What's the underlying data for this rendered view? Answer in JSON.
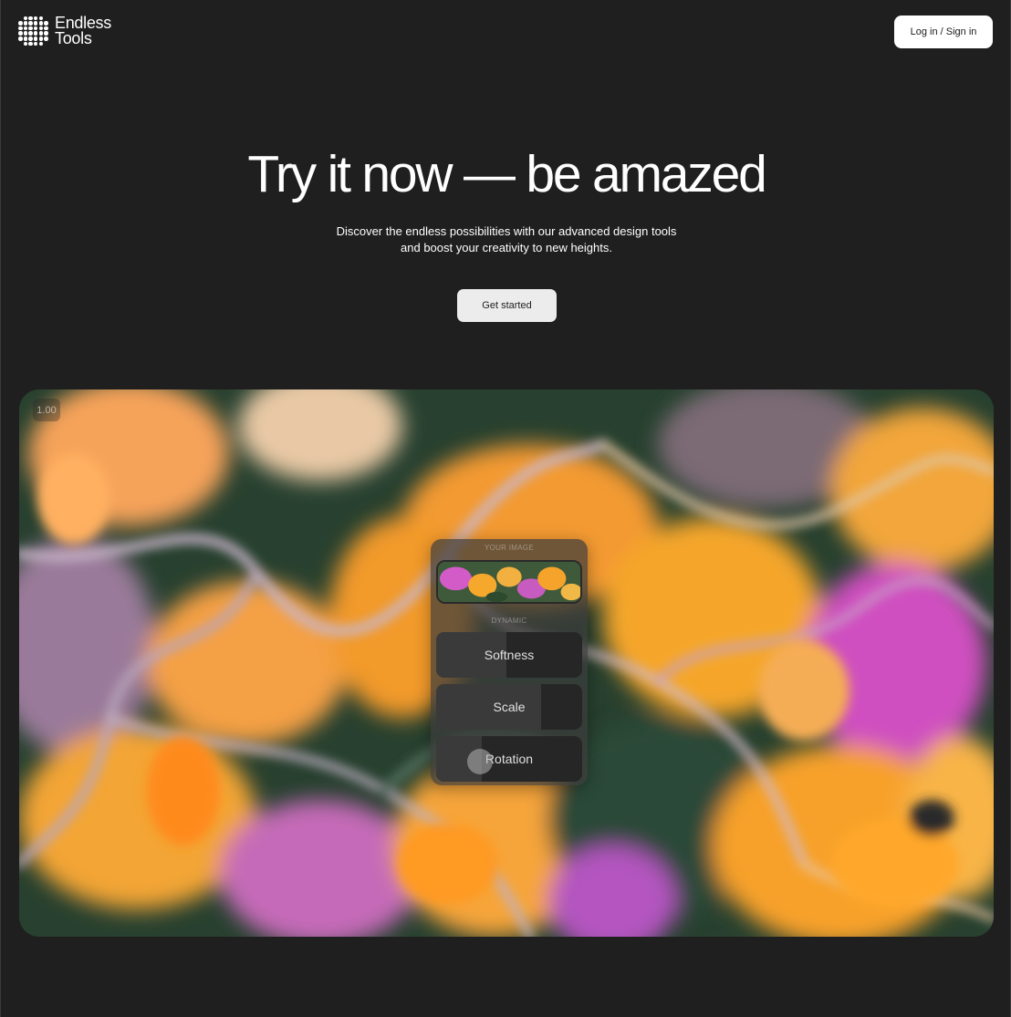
{
  "brand": {
    "name_line1": "Endless",
    "name_line2": "Tools"
  },
  "header": {
    "login_label": "Log in / Sign in"
  },
  "hero": {
    "title": "Try it now — be amazed",
    "subtitle_line1": "Discover the endless possibilities with our advanced design tools",
    "subtitle_line2": "and boost your creativity to new heights.",
    "cta_label": "Get started"
  },
  "demo": {
    "zoom_value": "1.00",
    "panel": {
      "image_label": "YOUR IMAGE",
      "section_label": "DYNAMIC",
      "sliders": [
        {
          "label": "Softness",
          "value": 0.48
        },
        {
          "label": "Scale",
          "value": 0.72
        },
        {
          "label": "Rotation",
          "value": 0.31
        }
      ]
    }
  },
  "colors": {
    "background": "#1f1f1f",
    "accent_orange": "#f7a32a",
    "accent_magenta": "#c04bb4",
    "foliage_green": "#23402e"
  }
}
